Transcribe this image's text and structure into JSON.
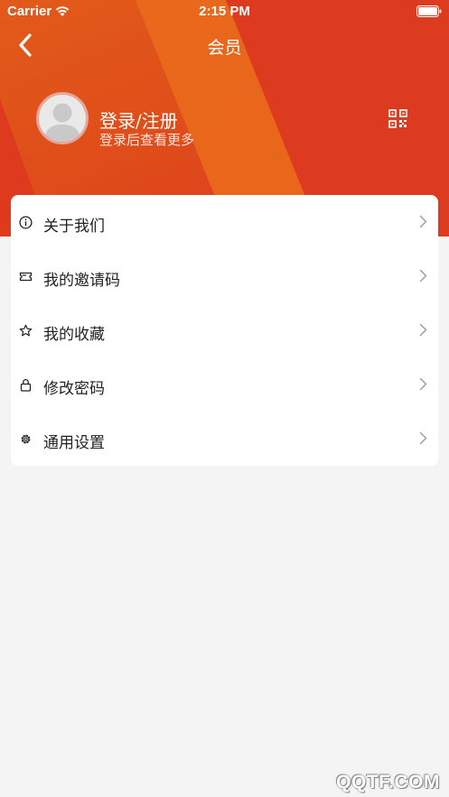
{
  "status_bar": {
    "carrier": "Carrier",
    "time": "2:15 PM"
  },
  "nav": {
    "title": "会员"
  },
  "profile": {
    "login_title": "登录/注册",
    "login_subtitle": "登录后查看更多"
  },
  "menu": {
    "items": [
      {
        "label": "关于我们",
        "icon": "info-icon"
      },
      {
        "label": "我的邀请码",
        "icon": "ticket-icon"
      },
      {
        "label": "我的收藏",
        "icon": "star-icon"
      },
      {
        "label": "修改密码",
        "icon": "lock-icon"
      },
      {
        "label": "通用设置",
        "icon": "gear-icon"
      }
    ]
  },
  "watermark": "QQTF.COM",
  "colors": {
    "hero": "#dd3a1e",
    "hero_accent": "#e86a1f",
    "background": "#f4f4f4",
    "card": "#ffffff"
  }
}
